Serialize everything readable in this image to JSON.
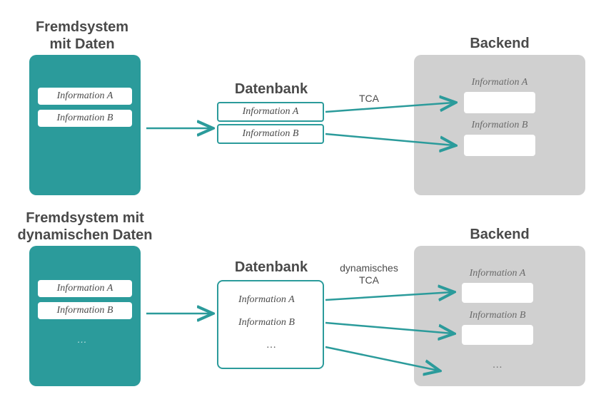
{
  "top": {
    "source_title_line1": "Fremdsystem",
    "source_title_line2": "mit Daten",
    "source_items": [
      "Information A",
      "Information B"
    ],
    "db_title": "Datenbank",
    "db_items": [
      "Information A",
      "Information B"
    ],
    "connector_label": "TCA",
    "backend_title": "Backend",
    "backend_items": [
      "Information A",
      "Information B"
    ]
  },
  "bottom": {
    "source_title_line1": "Fremdsystem mit",
    "source_title_line2": "dynamischen Daten",
    "source_items": [
      "Information A",
      "Information B"
    ],
    "source_ellipsis": "…",
    "db_title": "Datenbank",
    "db_items": [
      "Information A",
      "Information B"
    ],
    "db_ellipsis": "…",
    "connector_label_line1": "dynamisches",
    "connector_label_line2": "TCA",
    "backend_title": "Backend",
    "backend_items": [
      "Information A",
      "Information B"
    ],
    "backend_ellipsis": "…"
  },
  "colors": {
    "teal": "#2b9b9b",
    "grey": "#d0d0d0"
  }
}
